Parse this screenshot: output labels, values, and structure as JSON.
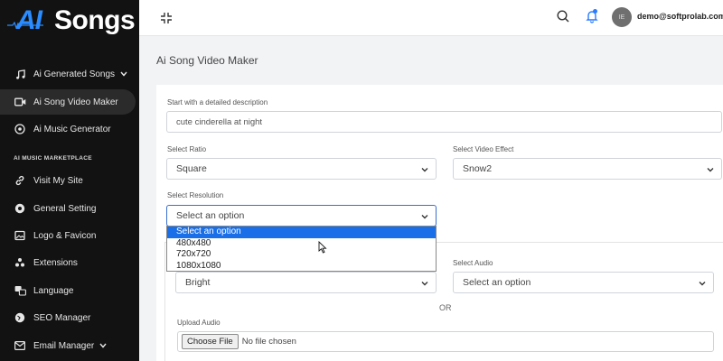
{
  "brand": {
    "logo_ai": "AI",
    "logo_songs": "Songs"
  },
  "sidebar": {
    "items": [
      {
        "label": "Ai Generated Songs",
        "icon": "music-note-icon"
      },
      {
        "label": "Ai Song Video Maker",
        "icon": "video-icon"
      },
      {
        "label": "Ai Music Generator",
        "icon": "music-generator-icon"
      }
    ],
    "section_label": "AI MUSIC MARKETPLACE",
    "marketplace_items": [
      {
        "label": "Visit My Site",
        "icon": "link-icon"
      },
      {
        "label": "General Setting",
        "icon": "settings-icon"
      },
      {
        "label": "Logo & Favicon",
        "icon": "image-icon"
      },
      {
        "label": "Extensions",
        "icon": "extensions-icon"
      },
      {
        "label": "Language",
        "icon": "language-icon"
      },
      {
        "label": "SEO Manager",
        "icon": "globe-icon"
      },
      {
        "label": "Email Manager",
        "icon": "email-icon"
      }
    ]
  },
  "topbar": {
    "user_email": "demo@softprolab.com",
    "avatar_initials": "IE"
  },
  "page": {
    "title": "Ai Song Video Maker"
  },
  "form": {
    "description_label": "Start with a detailed description",
    "description_value": "cute cinderella at night",
    "ratio_label": "Select Ratio",
    "ratio_value": "Square",
    "effect_label": "Select Video Effect",
    "effect_value": "Snow2",
    "resolution_label": "Select Resolution",
    "resolution_value": "Select an option",
    "resolution_options": [
      "Select an option",
      "480x480",
      "720x720",
      "1080x1080"
    ],
    "style_value": "Bright",
    "audio_label": "Select Audio",
    "audio_value": "Select an option",
    "or_label": "OR",
    "upload_label": "Upload Audio",
    "file_button": "Choose File",
    "file_status": "No file chosen"
  },
  "colors": {
    "accent": "#1a6fe8",
    "sidebar_bg": "#121212",
    "logo_blue": "#2a8cff"
  }
}
